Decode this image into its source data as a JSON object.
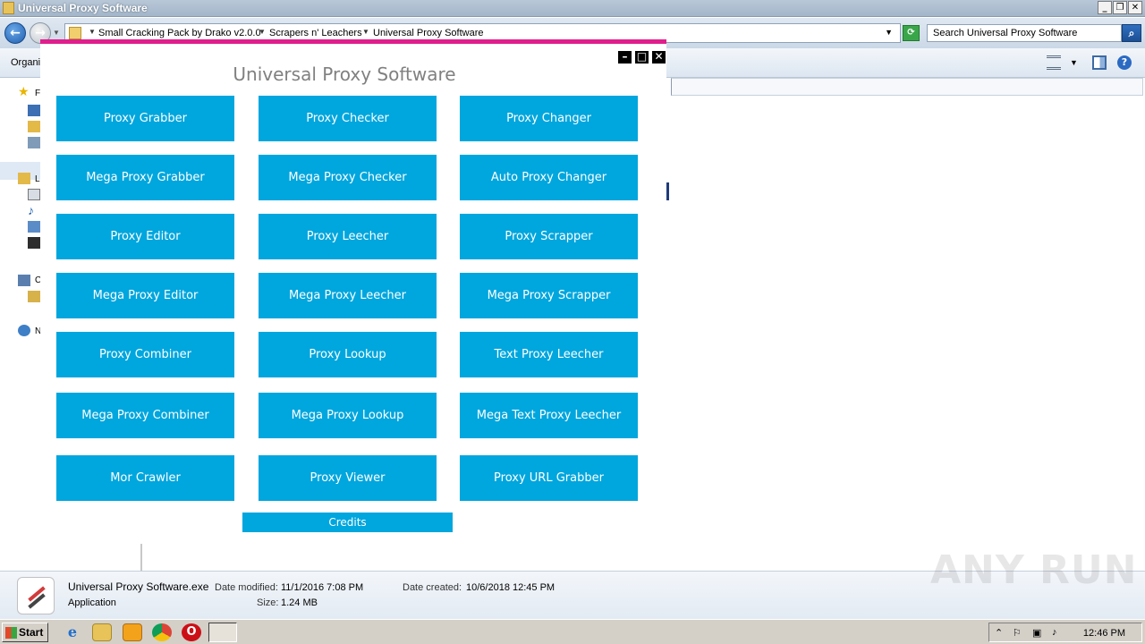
{
  "window": {
    "title": "Universal Proxy Software",
    "min": "_",
    "restore": "❐",
    "close": "✕"
  },
  "address": {
    "crumbs": [
      "Small Cracking Pack by Drako v2.0.0",
      "Scrapers n' Leachers",
      "Universal Proxy Software"
    ],
    "search_placeholder": "Search Universal Proxy Software"
  },
  "toolbar": {
    "organize": "Organi"
  },
  "nav": {
    "labels": [
      "F",
      "L",
      "C",
      "N"
    ]
  },
  "app": {
    "title": "Universal Proxy Software",
    "buttons": [
      "Proxy Grabber",
      "Proxy Checker",
      "Proxy Changer",
      "Mega Proxy Grabber",
      "Mega Proxy Checker",
      "Auto Proxy Changer",
      "Proxy Editor",
      "Proxy Leecher",
      "Proxy Scrapper",
      "Mega Proxy Editor",
      "Mega Proxy Leecher",
      "Mega Proxy Scrapper",
      "Proxy Combiner",
      "Proxy Lookup",
      "Text Proxy Leecher",
      "Mega Proxy Combiner",
      "Mega Proxy Lookup",
      "Mega Text Proxy Leecher",
      "Mor Crawler",
      "Proxy Viewer",
      "Proxy URL Grabber"
    ],
    "credits": "Credits"
  },
  "details": {
    "filename": "Universal Proxy Software.exe",
    "type": "Application",
    "date_modified_label": "Date modified:",
    "date_modified": "11/1/2016 7:08 PM",
    "size_label": "Size:",
    "size": "1.24 MB",
    "date_created_label": "Date created:",
    "date_created": "10/6/2018 12:45 PM"
  },
  "watermark": "ANY RUN",
  "taskbar": {
    "start": "Start",
    "clock": "12:46 PM"
  },
  "colors": {
    "tile": "#00a6de",
    "accent": "#e01e8c"
  }
}
